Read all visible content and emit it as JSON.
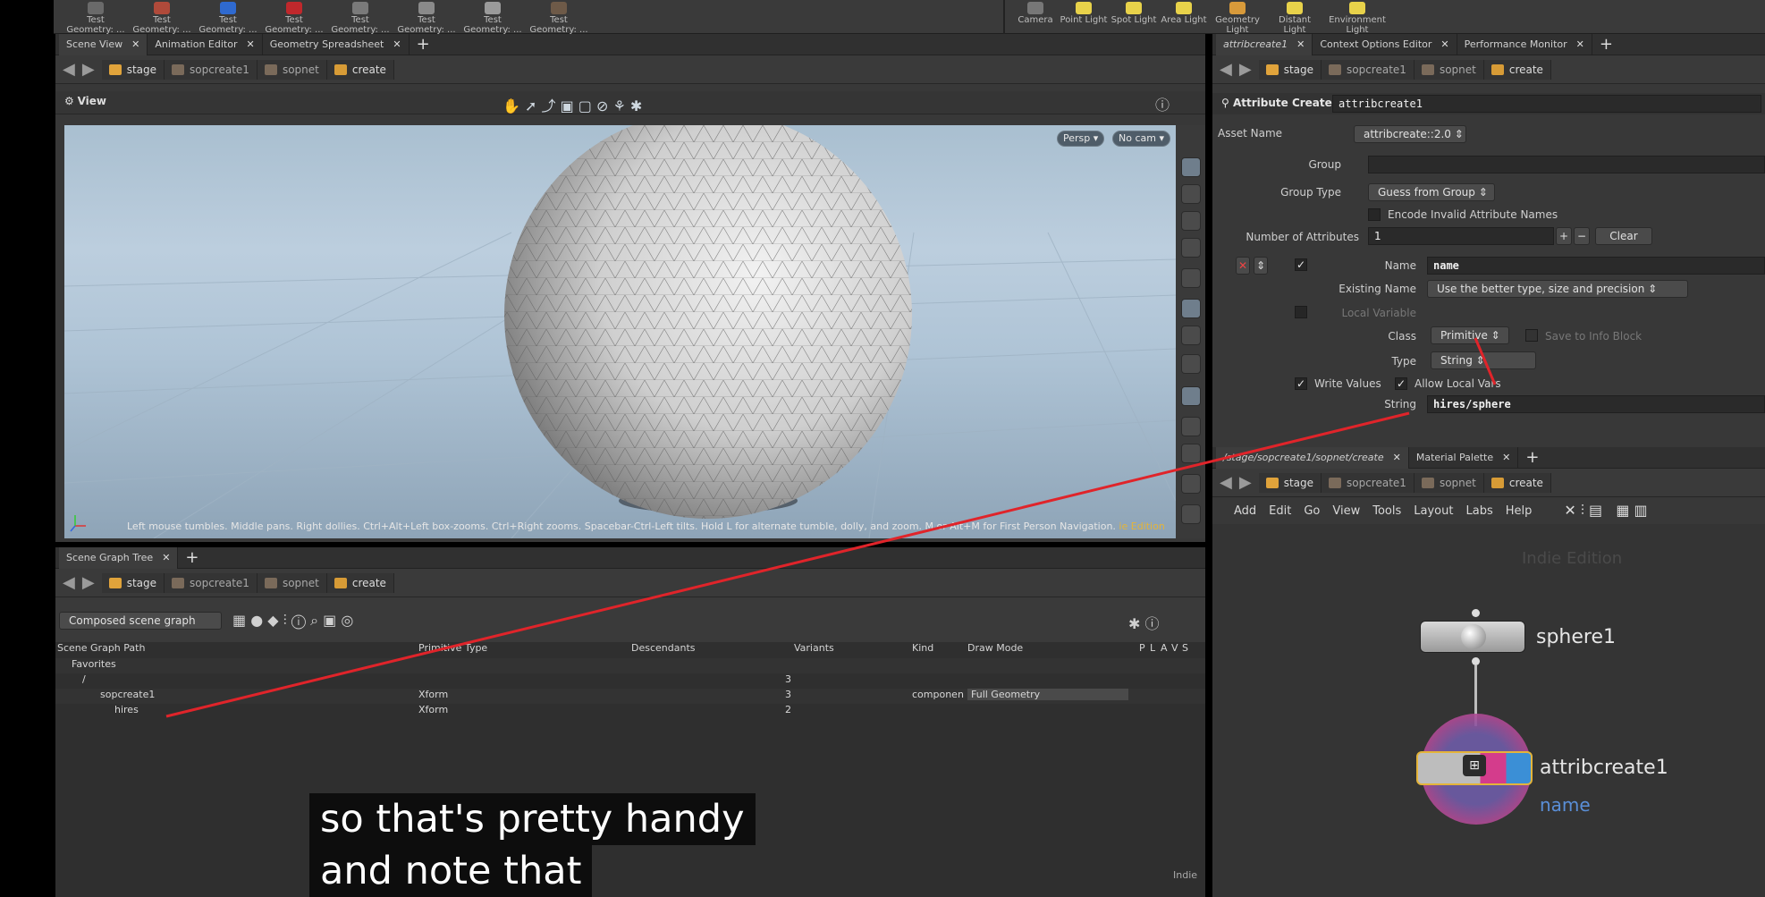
{
  "shelf": {
    "tools": [
      {
        "label": "Test Geometry: ...",
        "icon": "test-geometry-icon"
      },
      {
        "label": "Test Geometry: ...",
        "icon": "test-geometry-icon"
      },
      {
        "label": "Test Geometry: ...",
        "icon": "test-geometry-icon"
      },
      {
        "label": "Test Geometry: ...",
        "icon": "test-geometry-icon"
      },
      {
        "label": "Test Geometry: ...",
        "icon": "test-geometry-icon"
      },
      {
        "label": "Test Geometry: ...",
        "icon": "test-geometry-icon"
      },
      {
        "label": "Test Geometry: ...",
        "icon": "test-geometry-icon"
      },
      {
        "label": "Test Geometry: ...",
        "icon": "test-geometry-icon"
      }
    ],
    "lights": [
      {
        "label": "Camera"
      },
      {
        "label": "Point Light"
      },
      {
        "label": "Spot Light"
      },
      {
        "label": "Area Light"
      },
      {
        "label": "Geometry Light"
      },
      {
        "label": "Distant Light"
      },
      {
        "label": "Environment Light"
      }
    ]
  },
  "left_tabs": [
    "Scene View",
    "Animation Editor",
    "Geometry Spreadsheet"
  ],
  "path": {
    "stage": "stage",
    "sop": "sopcreate1",
    "sopnet": "sopnet",
    "create": "create"
  },
  "viewport": {
    "title": "View",
    "persp": "Persp",
    "cam": "No cam",
    "hint": "Left mouse tumbles. Middle pans. Right dollies. Ctrl+Alt+Left box-zooms. Ctrl+Right zooms. Spacebar-Ctrl-Left tilts. Hold L for alternate tumble, dolly, and zoom.    M or Alt+M for First Person Navigation.",
    "edition": "ie Edition"
  },
  "scene_graph": {
    "tab": "Scene Graph Tree",
    "mode": "Composed scene graph",
    "columns": [
      "Scene Graph Path",
      "Primitive Type",
      "Descendants",
      "Variants",
      "Kind",
      "Draw Mode",
      "P",
      "L",
      "A",
      "V",
      "S"
    ],
    "rows": [
      {
        "path": "Favorites",
        "type": "",
        "desc": "",
        "kind": "",
        "draw": ""
      },
      {
        "path": "/",
        "type": "",
        "desc": "3",
        "kind": "",
        "draw": ""
      },
      {
        "path": "sopcreate1",
        "type": "Xform",
        "desc": "3",
        "kind": "componen",
        "draw": "Full Geometry"
      },
      {
        "path": "hires",
        "type": "Xform",
        "desc": "2",
        "kind": "",
        "draw": ""
      }
    ],
    "footer": "Indie"
  },
  "params": {
    "tabs": [
      "attribcreate1",
      "Context Options Editor",
      "Performance Monitor"
    ],
    "node_type": "Attribute Create",
    "node_name": "attribcreate1",
    "asset_name_label": "Asset Name",
    "asset_name": "attribcreate::2.0",
    "group_label": "Group",
    "group_value": "",
    "group_type_label": "Group Type",
    "group_type": "Guess from Group",
    "encode_label": "Encode Invalid Attribute Names",
    "num_attr_label": "Number of Attributes",
    "num_attr": "1",
    "clear": "Clear",
    "name_label": "Name",
    "name_value": "name",
    "existing_label": "Existing Name",
    "existing_value": "Use the better type, size and precision",
    "local_var_label": "Local Variable",
    "class_label": "Class",
    "class_value": "Primitive",
    "save_info": "Save to Info Block",
    "type_label": "Type",
    "type_value": "String",
    "write_values": "Write Values",
    "allow_local": "Allow Local Vars",
    "string_label": "String",
    "string_value": "hires/sphere"
  },
  "network": {
    "tabs": [
      "/stage/sopcreate1/sopnet/create",
      "Material Palette"
    ],
    "menu": [
      "Add",
      "Edit",
      "Go",
      "View",
      "Tools",
      "Layout",
      "Labs",
      "Help"
    ],
    "watermark": "Indie Edition",
    "node1": "sphere1",
    "node2": "attribcreate1",
    "node2_attr": "name"
  },
  "caption": {
    "line1": "so that's pretty handy",
    "line2": "and note that"
  },
  "colors": {
    "annotation": "#e0242a",
    "node_pink": "#d43c8c",
    "node_blue": "#3b8fd6",
    "accent_yellow": "#e4b43a"
  }
}
